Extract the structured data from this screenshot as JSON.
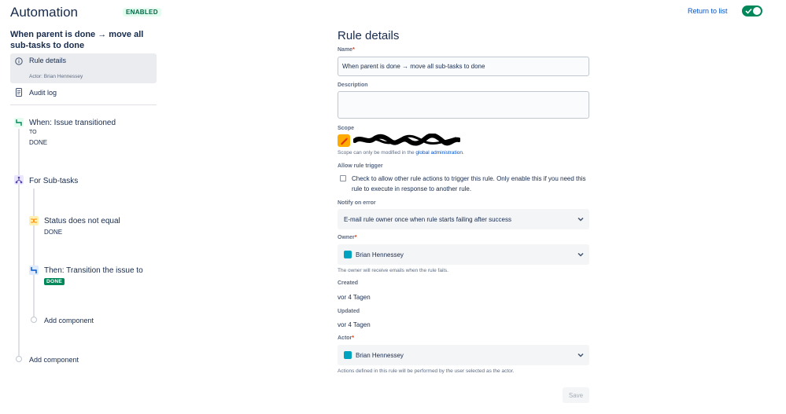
{
  "header": {
    "app_title": "Automation",
    "status_badge": "ENABLED",
    "return_link": "Return to list",
    "toggle_state": "on",
    "accent": "#00875a"
  },
  "sidebar": {
    "rule_name": "When parent is done → move all sub-tasks to done",
    "nav": [
      {
        "label": "Rule details",
        "sublabel": "Actor: Brian Hennessey",
        "icon": "info-icon",
        "selected": true
      },
      {
        "label": "Audit log",
        "icon": "document-icon",
        "selected": false
      }
    ],
    "components": {
      "trigger": {
        "title": "When: Issue transitioned",
        "to_label": "TO",
        "to_value": "DONE",
        "icon": "trigger-icon"
      },
      "branch": {
        "title": "For Sub-tasks",
        "icon": "branch-icon"
      },
      "condition": {
        "title": "Status does not equal",
        "value": "DONE",
        "icon": "condition-icon"
      },
      "action": {
        "title": "Then: Transition the issue to",
        "status": "DONE",
        "icon": "action-icon"
      },
      "add_inner": "Add component",
      "add_outer": "Add component"
    }
  },
  "main": {
    "title": "Rule details",
    "name": {
      "label": "Name",
      "value": "When parent is done → move all sub-tasks to done"
    },
    "description": {
      "label": "Description",
      "value": ""
    },
    "scope": {
      "label": "Scope",
      "hint_prefix": "Scope can only be modified in the ",
      "hint_link": "global administration",
      "hint_suffix": "."
    },
    "allow_trigger": {
      "label": "Allow rule trigger",
      "checkbox_text": "Check to allow other rule actions to trigger this rule. Only enable this if you need this rule to execute in response to another rule.",
      "checked": false
    },
    "notify": {
      "label": "Notify on error",
      "value": "E-mail rule owner once when rule starts failing after success"
    },
    "owner": {
      "label": "Owner",
      "value": "Brian Hennessey",
      "hint": "The owner will receive emails when the rule fails."
    },
    "created": {
      "label": "Created",
      "value": "vor 4 Tagen"
    },
    "updated": {
      "label": "Updated",
      "value": "vor 4 Tagen"
    },
    "actor": {
      "label": "Actor",
      "value": "Brian Hennessey",
      "hint": "Actions defined in this rule will be performed by the user selected as the actor."
    },
    "save_label": "Save"
  }
}
